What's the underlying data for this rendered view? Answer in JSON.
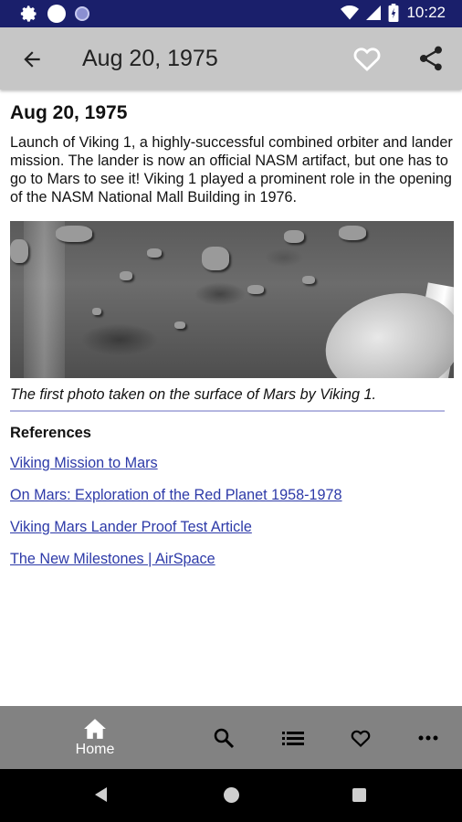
{
  "status_bar": {
    "time": "10:22"
  },
  "app_bar": {
    "title": "Aug 20, 1975"
  },
  "article": {
    "heading": "Aug 20, 1975",
    "body": "Launch of Viking 1, a highly-successful combined orbiter and lander mission. The lander is now an official NASM artifact, but one has to go to Mars to see it! Viking 1 played a prominent role in the opening of the NASM National Mall Building in 1976.",
    "caption": "The first photo taken on the surface of Mars by Viking 1."
  },
  "references": {
    "title": "References",
    "links": [
      "Viking Mission to Mars",
      "On Mars: Exploration of the Red Planet 1958-1978",
      "Viking Mars Lander Proof Test Article",
      "The New Milestones | AirSpace"
    ]
  },
  "bottom_nav": {
    "home_label": "Home"
  },
  "colors": {
    "status_bar": "#1a1f6b",
    "app_bar": "#c6c6c6",
    "link": "#2d3aa8",
    "bottom_nav": "#828282"
  }
}
